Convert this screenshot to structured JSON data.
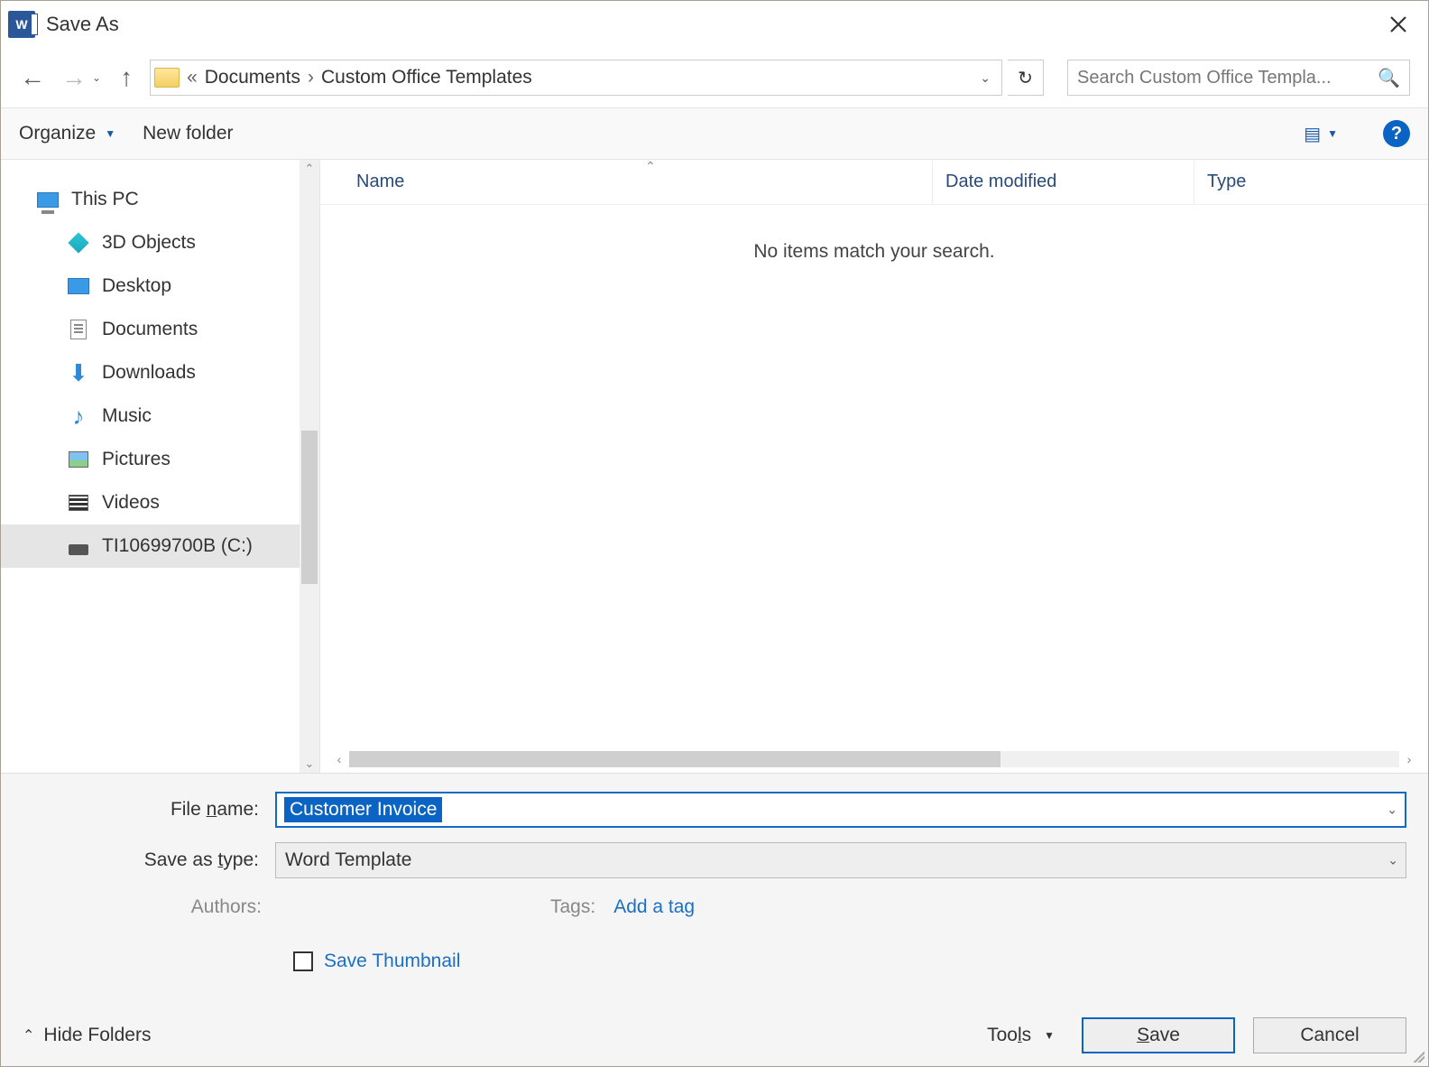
{
  "title": "Save As",
  "breadcrumb": {
    "sep0": "«",
    "item0": "Documents",
    "sep1": "›",
    "item1": "Custom Office Templates"
  },
  "search": {
    "placeholder": "Search Custom Office Templa..."
  },
  "toolbar": {
    "organize": "Organize",
    "newfolder": "New folder"
  },
  "tree": {
    "root": "This PC",
    "items": [
      "3D Objects",
      "Desktop",
      "Documents",
      "Downloads",
      "Music",
      "Pictures",
      "Videos",
      "TI10699700B (C:)"
    ]
  },
  "columns": {
    "name": "Name",
    "date": "Date modified",
    "type": "Type"
  },
  "empty_message": "No items match your search.",
  "form": {
    "filename_label": "File name:",
    "filename_value": "Customer Invoice",
    "savetype_label": "Save as type:",
    "savetype_value": "Word Template",
    "authors_label": "Authors:",
    "tags_label": "Tags:",
    "tags_link": "Add a tag",
    "thumbnail_label": "Save Thumbnail"
  },
  "footer": {
    "hide_folders": "Hide Folders",
    "tools": "Tools",
    "save": "Save",
    "cancel": "Cancel"
  }
}
